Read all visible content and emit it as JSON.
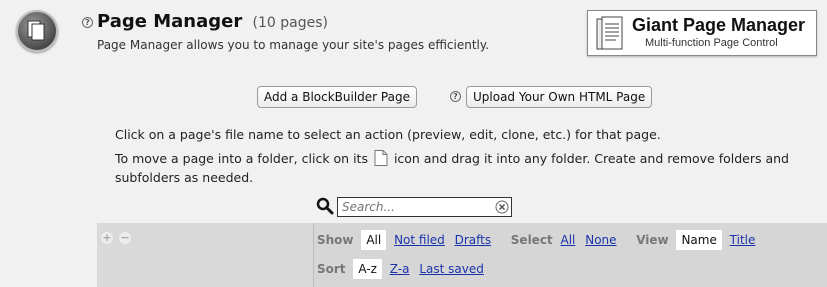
{
  "header": {
    "title": "Page Manager",
    "count": "(10 pages)",
    "description": "Page Manager allows you to manage your site's pages efficiently."
  },
  "logo": {
    "title": "Giant Page Manager",
    "subtitle": "Multi-function Page Control"
  },
  "buttons": {
    "add_blockbuilder": "Add a BlockBuilder Page",
    "upload_html": "Upload Your Own HTML Page"
  },
  "help_glyph": "?",
  "instructions": {
    "line1": "Click on a page's file name to select an action (preview, edit, clone, etc.) for that page.",
    "line2_before": "To move a page into a folder, click on its",
    "line2_after": "icon and drag it into any folder. Create and remove folders and",
    "line3": "subfolders as needed."
  },
  "search": {
    "placeholder": "Search..."
  },
  "folder_controls": {
    "add": "+",
    "remove": "−"
  },
  "filters": {
    "show_label": "Show",
    "show_options": [
      "All",
      "Not filed",
      "Drafts"
    ],
    "show_selected": "All",
    "select_label": "Select",
    "select_options": [
      "All",
      "None"
    ],
    "view_label": "View",
    "view_options": [
      "Name",
      "Title"
    ],
    "view_selected": "Name",
    "sort_label": "Sort",
    "sort_options": [
      "A-z",
      "Z-a",
      "Last saved"
    ],
    "sort_selected": "A-z"
  },
  "colors": {
    "background": "#f1f1f1",
    "link": "#1a33aa",
    "toolbar": "#d6d6d6"
  }
}
